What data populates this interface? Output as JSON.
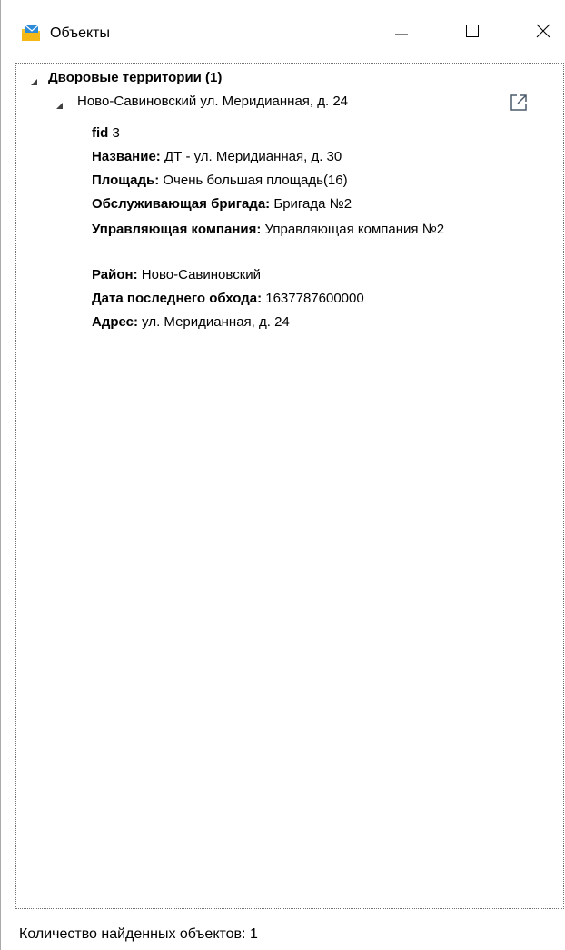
{
  "window": {
    "title": "Объекты",
    "icon": "folder-envelope-icon",
    "controls": [
      "minimize-icon",
      "maximize-icon",
      "close-icon"
    ]
  },
  "tree": {
    "group": {
      "label": "Дворовые территории (1)",
      "expanded": true
    },
    "item": {
      "label": "Ново-Савиновский ул. Меридианная, д. 24",
      "expanded": true,
      "action_icon": "open-external-icon"
    },
    "attributes": [
      {
        "key": "fid",
        "value": "3"
      },
      {
        "key": "Название:",
        "value": "ДТ - ул. Меридианная, д. 30"
      },
      {
        "key": "Площадь:",
        "value": "Очень большая площадь(16)"
      },
      {
        "key": "Обслуживающая бригада:",
        "value": "Бригада №2"
      },
      {
        "key": "Управляющая компания:",
        "value": "Управляющая компания №2"
      },
      {
        "key": "Район:",
        "value": "Ново-Савиновский"
      },
      {
        "key": "Дата последнего обхода:",
        "value": "1637787600000"
      },
      {
        "key": "Адрес:",
        "value": "ул. Меридианная, д. 24"
      }
    ]
  },
  "status": {
    "text": "Количество найденных объектов: 1"
  },
  "colors": {
    "icon_yellow": "#F2C230",
    "icon_blue": "#2E8BD8",
    "border_dotted": "#707070",
    "link_icon": "#4a5a6a"
  }
}
